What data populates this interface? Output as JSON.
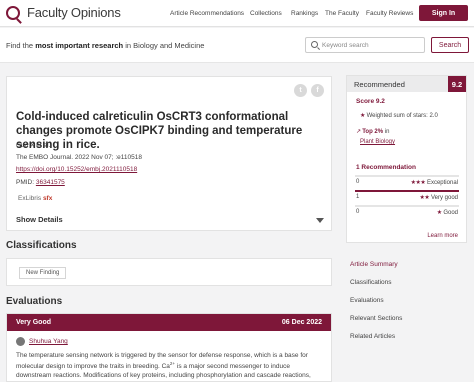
{
  "brand": {
    "name": "Faculty Opinions"
  },
  "nav": {
    "items": [
      "Article Recommendations",
      "Collections",
      "Rankings",
      "The Faculty",
      "Faculty Reviews"
    ],
    "sign_in": "Sign In"
  },
  "search": {
    "tagline_pre": "Find the ",
    "tagline_bold": "most important research",
    "tagline_post": " in Biology and Medicine",
    "placeholder": "Keyword search",
    "button": "Search"
  },
  "article": {
    "title": "Cold-induced calreticulin OsCRT3 conformational changes promote OsCIPK7 binding and temperature sensing in rice.",
    "authors": "Guo X et al.",
    "journal": "The EMBO Journal. 2022 Nov 07; :e110518",
    "doi": "https://doi.org/10.15252/embj.2021110518",
    "pmid_label": "PMID: ",
    "pmid": "36341575",
    "exlibris": "ExLibris",
    "exlibris_sfx": "sfx",
    "show_details": "Show Details",
    "share_twitter": "t",
    "share_facebook": "f"
  },
  "classifications": {
    "title": "Classifications",
    "items": [
      "New Finding"
    ]
  },
  "evaluations": {
    "title": "Evaluations",
    "rating": "Very Good",
    "date": "06 Dec 2022",
    "author": "Shuhua Yang",
    "text_pre": "The temperature sensing network is triggered by the sensor for defense response, which is a base for molecular design to improve the traits in breeding. Ca",
    "text_sup": "2+",
    "text_post": " is a major second messenger to induce downstream reactions. Modifications of key proteins, including phosphorylation and cascade reactions,"
  },
  "recommended": {
    "title": "Recommended",
    "score_badge": "9.2",
    "score": "Score 9.2",
    "weighted": "Weighted sum of stars: 2.0",
    "top": "Top 2%",
    "top_in": " in",
    "category": "Plant Biology",
    "count": "1 Recommendation",
    "rows": [
      {
        "value": "0",
        "stars": "★★★",
        "label": "Exceptional",
        "fraction": 0
      },
      {
        "value": "1",
        "stars": "★★",
        "label": "Very good",
        "fraction": 1
      },
      {
        "value": "0",
        "stars": "★",
        "label": "Good",
        "fraction": 0
      }
    ],
    "learn_more": "Learn more"
  },
  "side_links": [
    "Article Summary",
    "Classifications",
    "Evaluations",
    "Relevant Sections",
    "Related Articles"
  ],
  "colors": {
    "brand": "#7e1739"
  }
}
